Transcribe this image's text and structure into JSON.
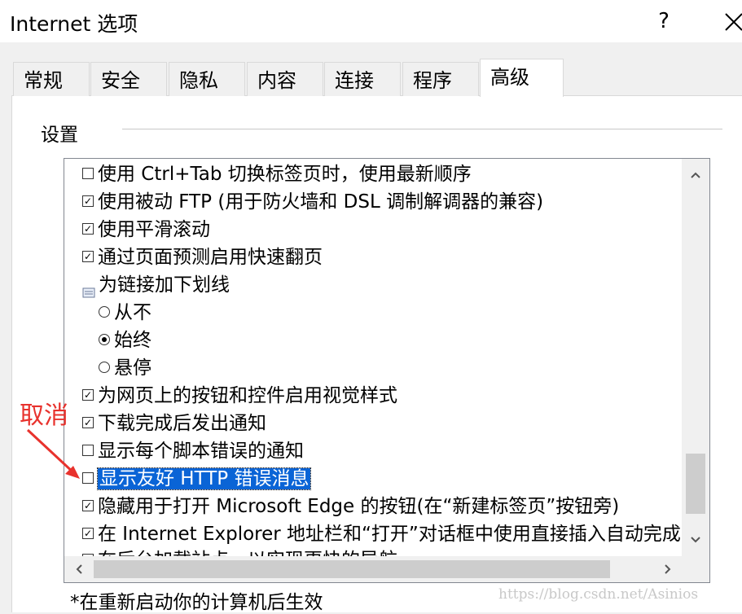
{
  "window": {
    "title": "Internet 选项",
    "help": "?"
  },
  "tabs": [
    {
      "label": "常规"
    },
    {
      "label": "安全"
    },
    {
      "label": "隐私"
    },
    {
      "label": "内容"
    },
    {
      "label": "连接"
    },
    {
      "label": "程序"
    },
    {
      "label": "高级",
      "active": true
    }
  ],
  "settings": {
    "group_label": "设置",
    "items": [
      {
        "type": "checkbox",
        "checked": false,
        "label": "使用 Ctrl+Tab 切换标签页时，使用最新顺序"
      },
      {
        "type": "checkbox",
        "checked": true,
        "label": "使用被动 FTP (用于防火墙和 DSL 调制解调器的兼容)"
      },
      {
        "type": "checkbox",
        "checked": true,
        "label": "使用平滑滚动"
      },
      {
        "type": "checkbox",
        "checked": true,
        "label": "通过页面预测启用快速翻页"
      },
      {
        "type": "group",
        "label": "为链接加下划线"
      },
      {
        "type": "radio",
        "checked": false,
        "label": "从不"
      },
      {
        "type": "radio",
        "checked": true,
        "label": "始终"
      },
      {
        "type": "radio",
        "checked": false,
        "label": "悬停"
      },
      {
        "type": "checkbox",
        "checked": true,
        "label": "为网页上的按钮和控件启用视觉样式"
      },
      {
        "type": "checkbox",
        "checked": true,
        "label": "下载完成后发出通知"
      },
      {
        "type": "checkbox",
        "checked": false,
        "label": "显示每个脚本错误的通知"
      },
      {
        "type": "checkbox",
        "checked": false,
        "label": "显示友好 HTTP 错误消息",
        "selected": true
      },
      {
        "type": "checkbox",
        "checked": true,
        "label": "隐藏用于打开 Microsoft Edge 的按钮(在“新建标签页”按钮旁)"
      },
      {
        "type": "checkbox",
        "checked": true,
        "label": "在 Internet Explorer 地址栏和“打开”对话框中使用直接插入自动完成"
      },
      {
        "type": "checkbox",
        "checked": true,
        "label": "在后台加载站点，以实现更快的导航"
      }
    ]
  },
  "footnote": "*在重新启动你的计算机后生效",
  "annotation": {
    "text": "取消",
    "color": "#e8322d"
  },
  "watermark": "https://blog.csdn.net/Asinios",
  "colors": {
    "selection": "#0a64d6"
  }
}
